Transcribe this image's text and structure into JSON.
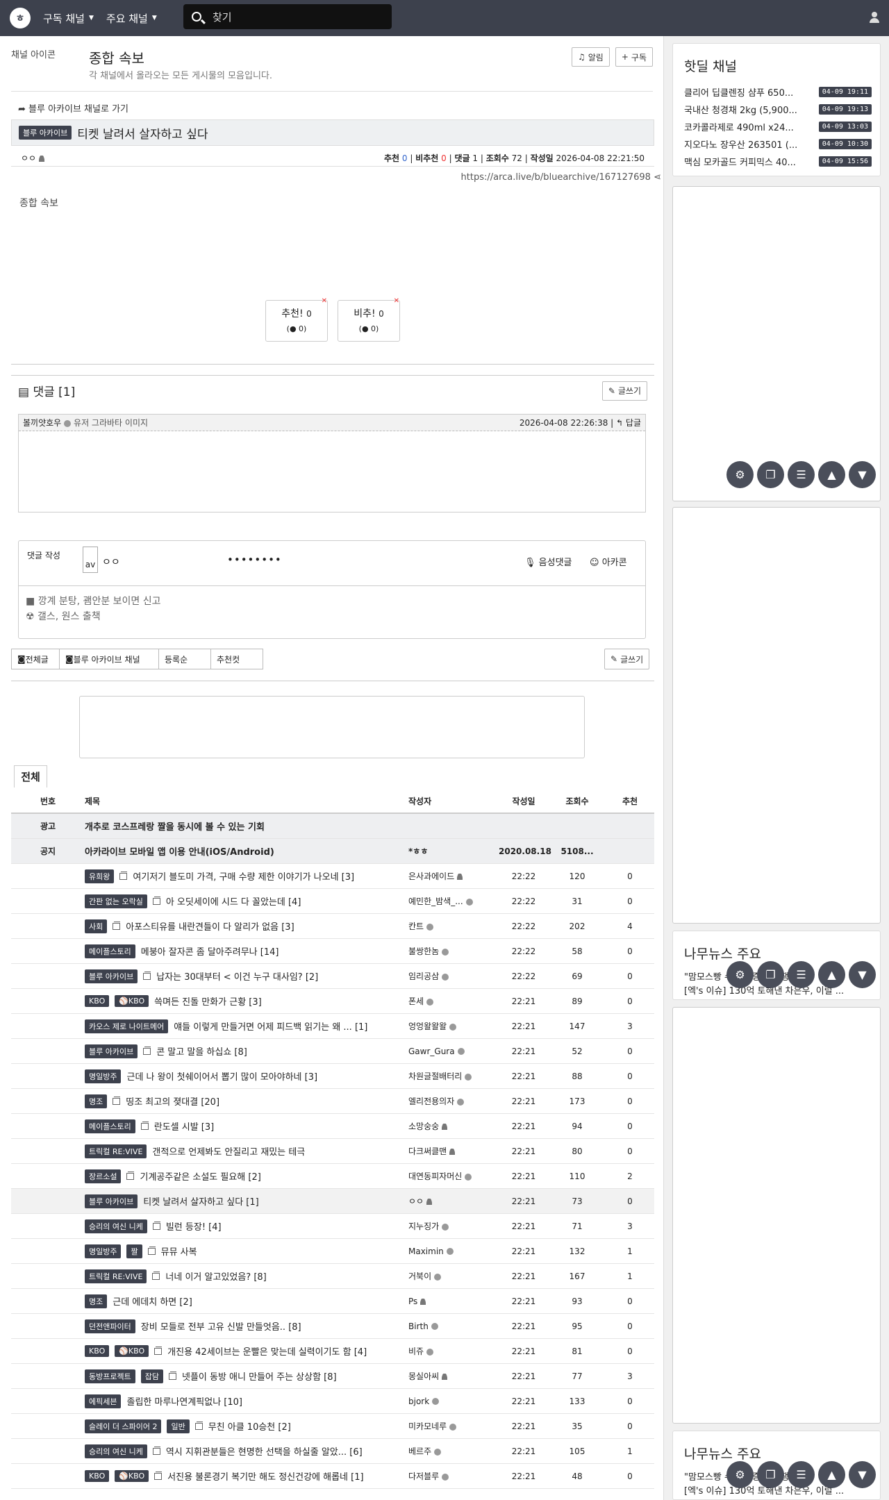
{
  "header": {
    "nav1": "구독 채널",
    "nav2": "주요 채널",
    "search_placeholder": "찾기"
  },
  "board": {
    "img_alt": "채널 아이콘",
    "title": "종합 속보",
    "desc": "각 채널에서 올라오는 모든 게시물의 모음입니다.",
    "alarm": "알림",
    "subscribe": "구독"
  },
  "article": {
    "back_link": "블루 아카이브 채널로 가기",
    "category": "블루 아카이브",
    "title": "티켓 날려서 살자하고 싶다",
    "author": "ㅇㅇ",
    "rec_label": "추천",
    "rec": "0",
    "unrec_label": "비추천",
    "unrec": "0",
    "cmt_label": "댓글",
    "cmt": "1",
    "views_label": "조회수",
    "views": "72",
    "date_label": "작성일",
    "date": "2026-04-08 22:21:50",
    "url": "https://arca.live/b/bluearchive/167127698",
    "img_alt": "종합 속보",
    "vote_up": "추천!",
    "vote_up_count": "0",
    "vote_up_sub": "0",
    "vote_down": "비추!",
    "vote_down_count": "0",
    "vote_down_sub": "0"
  },
  "comments": {
    "title": "댓글 [1]",
    "write": "글쓰기",
    "c1_author": "볼끼얏호우",
    "c1_img": "유저 그라바타 이미지",
    "c1_date": "2026-04-08 22:26:38",
    "reply": "답글"
  },
  "write": {
    "label": "댓글 작성",
    "avatar": "av",
    "name": "ㅇㅇ",
    "password": "••••••••",
    "voice": "음성댓글",
    "emoji": "아카콘",
    "rule1": "깡계 분탕, 괨안분 보이면 신고",
    "rule2": "갤스, 원스 출책"
  },
  "filters": {
    "all": "전체글",
    "channel": "블루 아카이브 채널",
    "sort": "등록순",
    "best": "추천컷",
    "write": "글쓰기"
  },
  "list": {
    "tab": "전체",
    "headers": [
      "번호",
      "제목",
      "작성자",
      "작성일",
      "조회수",
      "추천"
    ],
    "special": [
      {
        "num": "광고",
        "title": "개추로 코스프레랑 짤을 동시에 볼 수 있는 기회",
        "author": "",
        "date": "",
        "views": "",
        "rate": ""
      },
      {
        "num": "공지",
        "title": "아카라이브 모바일 앱 이용 안내(iOS/Android)",
        "author": "*ㅎㅎ",
        "date": "2020.08.18",
        "views": "5108...",
        "rate": ""
      }
    ],
    "rows": [
      {
        "cats": [
          "유희왕"
        ],
        "icon": true,
        "title": "여기저기 블도미 가격, 구매 수량 제한 이야기가 나오네 [3]",
        "author": "은사과에이드",
        "au": "p",
        "date": "22:22",
        "views": "120",
        "rate": "0"
      },
      {
        "cats": [
          "간판 없는 오락실"
        ],
        "icon": true,
        "title": "아 오딧세이에 시드 다 꼴았는데 [4]",
        "author": "예민한_밤색_...",
        "au": "v",
        "date": "22:22",
        "views": "31",
        "rate": "0"
      },
      {
        "cats": [
          "사회"
        ],
        "icon": true,
        "title": "아포스티유를 내란견들이 다 알리가 없음 [3]",
        "author": "칸트",
        "au": "v",
        "date": "22:22",
        "views": "202",
        "rate": "4"
      },
      {
        "cats": [
          "메이플스토리"
        ],
        "icon": false,
        "title": "메붕아 잘자콘 좀 달아주려무나 [14]",
        "author": "불쌍한놈",
        "au": "v",
        "date": "22:22",
        "views": "58",
        "rate": "0"
      },
      {
        "cats": [
          "블루 아카이브"
        ],
        "icon": true,
        "title": "납자는 30대부터 < 이건 누구 대사임? [2]",
        "author": "임리공삼",
        "au": "v",
        "date": "22:22",
        "views": "69",
        "rate": "0"
      },
      {
        "cats": [
          "KBO",
          "⚾KBO"
        ],
        "icon": false,
        "title": "쓱며든 진돌 만화가 근황 [3]",
        "author": "폰세",
        "au": "v",
        "date": "22:21",
        "views": "89",
        "rate": "0"
      },
      {
        "cats": [
          "카오스 제로 나이트메어"
        ],
        "icon": false,
        "title": "얘들 이렇게 만들거면 어제 피드백 읽기는 왜 ... [1]",
        "author": "엉엉왈왈왈",
        "au": "v",
        "date": "22:21",
        "views": "147",
        "rate": "3"
      },
      {
        "cats": [
          "블루 아카이브"
        ],
        "icon": true,
        "title": "콘 말고 말을 하십쇼 [8]",
        "author": "Gawr_Gura",
        "au": "v",
        "date": "22:21",
        "views": "52",
        "rate": "0"
      },
      {
        "cats": [
          "명일방주"
        ],
        "icon": false,
        "title": "근데 나 왕이 첫쉐이어서 뽑기 많이 모아야하네 [3]",
        "author": "차원글절배터리",
        "au": "v",
        "date": "22:21",
        "views": "88",
        "rate": "0"
      },
      {
        "cats": [
          "명조"
        ],
        "icon": true,
        "title": "띵조 최고의 졎대결 [20]",
        "author": "엘리전용의자",
        "au": "v",
        "date": "22:21",
        "views": "173",
        "rate": "0"
      },
      {
        "cats": [
          "메이플스토리"
        ],
        "icon": true,
        "title": "란도셀 시발 [3]",
        "author": "소망숭숭",
        "au": "p",
        "date": "22:21",
        "views": "94",
        "rate": "0"
      },
      {
        "cats": [
          "트릭컬 RE:VIVE"
        ],
        "icon": false,
        "title": "갠적으로 언제봐도 안질리고 재밌는 테극",
        "author": "다크써클맨",
        "au": "p",
        "date": "22:21",
        "views": "80",
        "rate": "0"
      },
      {
        "cats": [
          "장르소설"
        ],
        "icon": true,
        "title": "기계공주같은 소설도 필요해 [2]",
        "author": "대연동피자머신",
        "au": "v",
        "date": "22:21",
        "views": "110",
        "rate": "2"
      },
      {
        "cats": [
          "블루 아카이브"
        ],
        "icon": false,
        "title": "티켓 날려서 살자하고 싶다 [1]",
        "author": "ㅇㅇ",
        "au": "p",
        "date": "22:21",
        "views": "73",
        "rate": "0",
        "sel": true
      },
      {
        "cats": [
          "승리의 여신 니케"
        ],
        "icon": true,
        "title": "빌런 등장! [4]",
        "author": "지누징가",
        "au": "v",
        "date": "22:21",
        "views": "71",
        "rate": "3"
      },
      {
        "cats": [
          "명일방주",
          "짤"
        ],
        "icon": true,
        "title": "뮤뮤 사복",
        "author": "Maximin",
        "au": "v",
        "date": "22:21",
        "views": "132",
        "rate": "1"
      },
      {
        "cats": [
          "트릭컬 RE:VIVE"
        ],
        "icon": true,
        "title": "너네 이거 알고있었음? [8]",
        "author": "거북이",
        "au": "v",
        "date": "22:21",
        "views": "167",
        "rate": "1"
      },
      {
        "cats": [
          "명조"
        ],
        "icon": false,
        "title": "근데 에데치 하면 [2]",
        "author": "Ps",
        "au": "p",
        "date": "22:21",
        "views": "93",
        "rate": "0"
      },
      {
        "cats": [
          "던전앤파이터"
        ],
        "icon": false,
        "title": "장비 모들로 전부 고유 신발 만들엇음.. [8]",
        "author": "Birth",
        "au": "v",
        "date": "22:21",
        "views": "95",
        "rate": "0"
      },
      {
        "cats": [
          "KBO",
          "⚾KBO"
        ],
        "icon": true,
        "title": "개진용 42세이브는 운빨은 맞는데 실력이기도 함 [4]",
        "author": "비쥬",
        "au": "v",
        "date": "22:21",
        "views": "81",
        "rate": "0"
      },
      {
        "cats": [
          "동방프로젝트",
          "잡담"
        ],
        "icon": true,
        "title": "넷플이 동방 애니 만들어 주는 상상함 [8]",
        "author": "몽실아씨",
        "au": "p",
        "date": "22:21",
        "views": "77",
        "rate": "3"
      },
      {
        "cats": [
          "에픽세븐"
        ],
        "icon": false,
        "title": "졸립한 마루나연계픽없나 [10]",
        "author": "bjork",
        "au": "v",
        "date": "22:21",
        "views": "133",
        "rate": "0"
      },
      {
        "cats": [
          "슬레이 더 스파이어 2",
          "일반"
        ],
        "icon": true,
        "title": "무친 아클 10승천 [2]",
        "author": "미카모네루",
        "au": "v",
        "date": "22:21",
        "views": "35",
        "rate": "0"
      },
      {
        "cats": [
          "승리의 여신 니케"
        ],
        "icon": true,
        "title": "역시 지휘관분들은 현명한 선택을 하실줄 알았... [6]",
        "author": "베르주",
        "au": "v",
        "date": "22:21",
        "views": "105",
        "rate": "1"
      },
      {
        "cats": [
          "KBO",
          "⚾KBO"
        ],
        "icon": true,
        "title": "서진용 불론경기 복기만 해도 정신건강에 해롭네 [1]",
        "author": "다저블루",
        "au": "v",
        "date": "22:21",
        "views": "48",
        "rate": "0"
      }
    ]
  },
  "sidebar": {
    "hot_title": "핫딜 채널",
    "hot": [
      {
        "title": "클리어 딥클렌징 샴푸 650...",
        "time": "04-09 19:11"
      },
      {
        "title": "국내산 청경채 2kg (5,900...",
        "time": "04-09 19:13"
      },
      {
        "title": "코카콜라제로 490ml x24...",
        "time": "04-09 13:03"
      },
      {
        "title": "지오다노 장우산 263501 (...",
        "time": "04-09 10:30"
      },
      {
        "title": "맥심 모카골드 커피믹스 40...",
        "time": "04-09 15:56"
      }
    ],
    "news_title": "나무뉴스 주요",
    "news1": "\"맘모스빵 수요 폭증… 경쟁...",
    "news2": "[엑's 이슈] 130억 토해낸 차은우, 이럴 ..."
  }
}
